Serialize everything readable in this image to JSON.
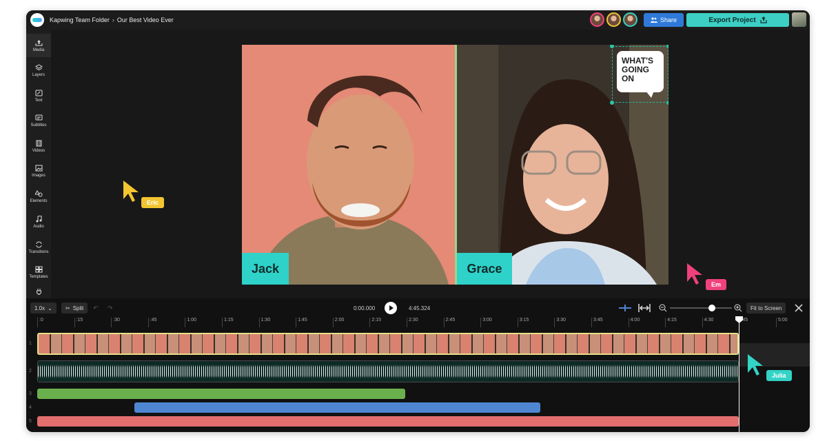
{
  "header": {
    "folder": "Kapwing Team Folder",
    "separator": "›",
    "project": "Our Best Video Ever",
    "share_label": "Share",
    "export_label": "Export Project"
  },
  "sidebar": {
    "items": [
      {
        "label": "Media",
        "icon": "upload-icon"
      },
      {
        "label": "Layers",
        "icon": "layers-icon"
      },
      {
        "label": "Text",
        "icon": "text-icon"
      },
      {
        "label": "Subtitles",
        "icon": "subtitles-icon"
      },
      {
        "label": "Videos",
        "icon": "videos-icon"
      },
      {
        "label": "Images",
        "icon": "images-icon"
      },
      {
        "label": "Elements",
        "icon": "elements-icon"
      },
      {
        "label": "Audio",
        "icon": "audio-icon"
      },
      {
        "label": "Transitions",
        "icon": "transitions-icon"
      },
      {
        "label": "Templates",
        "icon": "templates-icon"
      }
    ]
  },
  "canvas": {
    "left_name": "Jack",
    "right_name": "Grace",
    "sticker_lines": [
      "WHAT'S",
      "GOING",
      "ON"
    ]
  },
  "cursors": [
    {
      "name": "Eric",
      "color": "#f3c531"
    },
    {
      "name": "Em",
      "color": "#f0417c"
    },
    {
      "name": "Julia",
      "color": "#33d3c6"
    }
  ],
  "timeline": {
    "speed": "1.0x",
    "split_label": "Split",
    "current_time": "0:00.000",
    "total_time": "4:45.324",
    "fit_label": "Fit to Screen",
    "zoom_level": 0.68,
    "ticks": [
      ":0",
      ":15",
      ":30",
      ":45",
      "1:00",
      "1:15",
      "1:30",
      "1:45",
      "2:00",
      "2:15",
      "2:30",
      "2:45",
      "3:00",
      "3:15",
      "3:30",
      "3:45",
      "4:00",
      "4:15",
      "4:30",
      ":45",
      "5:00"
    ],
    "track_numbers": [
      "1",
      "2",
      "3",
      "4",
      "5"
    ],
    "track_colors": {
      "green": "#6ab04c",
      "blue": "#4f86d1",
      "red": "#e26e6e"
    }
  }
}
